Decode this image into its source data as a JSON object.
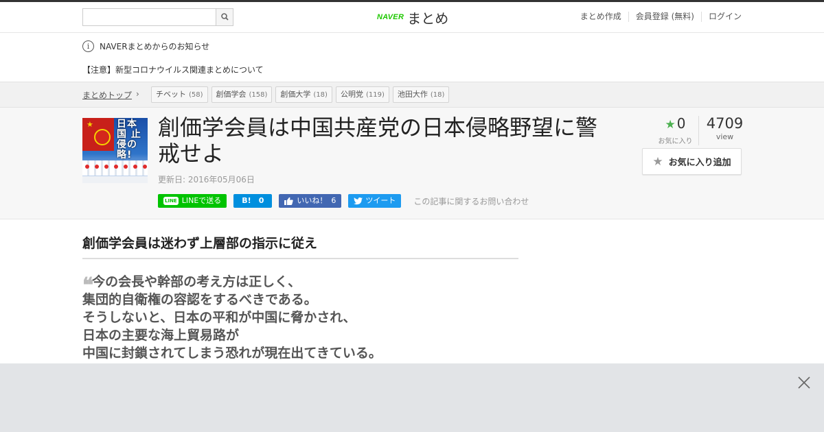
{
  "header": {
    "search_placeholder": "",
    "logo_naver": "NAVER",
    "logo_matome": "まとめ",
    "nav": [
      "まとめ作成",
      "会員登録 (無料)",
      "ログイン"
    ]
  },
  "notice": {
    "title": "NAVERまとめからのお知らせ",
    "item": "【注意】新型コロナウイルス関連まとめについて"
  },
  "breadcrumb": {
    "top_label": "まとめトップ",
    "tags": [
      {
        "label": "チベット",
        "count": "(58)"
      },
      {
        "label": "創価学会",
        "count": "(158)"
      },
      {
        "label": "創価大学",
        "count": "(18)"
      },
      {
        "label": "公明党",
        "count": "(119)"
      },
      {
        "label": "池田大作",
        "count": "(18)"
      }
    ]
  },
  "article": {
    "title": "創価学会員は中国共産党の日本侵略野望に警戒せよ",
    "updated": "更新日: 2016年05月06日",
    "thumbnail_text": "日本国 止侵の 略!",
    "share": {
      "line": "LINEで送る",
      "line_icon": "LINE",
      "hatena_icon": "B!",
      "hatena_count": "0",
      "facebook": "いいね！",
      "facebook_count": "6",
      "twitter": "ツイート"
    },
    "inquiry": "この記事に関するお問い合わせ",
    "favorites": {
      "count": "0",
      "label": "お気に入り"
    },
    "views": {
      "count": "4709",
      "label": "view"
    },
    "fav_button": "お気に入り追加"
  },
  "content": {
    "heading": "創価学会員は迷わず上層部の指示に従え",
    "quote_mark": "❝",
    "quote_lines": [
      "今の会長や幹部の考え方は正しく、",
      "集団的自衛権の容認をするべきである。",
      "そうしないと、日本の平和が中国に脅かされ、",
      "日本の主要な海上貿易路が",
      "中国に封鎖されてしまう恐れが現在出てきている。"
    ]
  },
  "overlay": {
    "close": "×"
  },
  "colors": {
    "accent_green": "#1ec800",
    "line": "#00c300",
    "hatena": "#008fde",
    "facebook": "#4267b2",
    "twitter": "#1d9bf0"
  },
  "icons": [
    "search-icon",
    "info-icon",
    "chevron-right-icon",
    "star-icon",
    "close-icon",
    "facebook-thumb-icon",
    "twitter-bird-icon"
  ]
}
